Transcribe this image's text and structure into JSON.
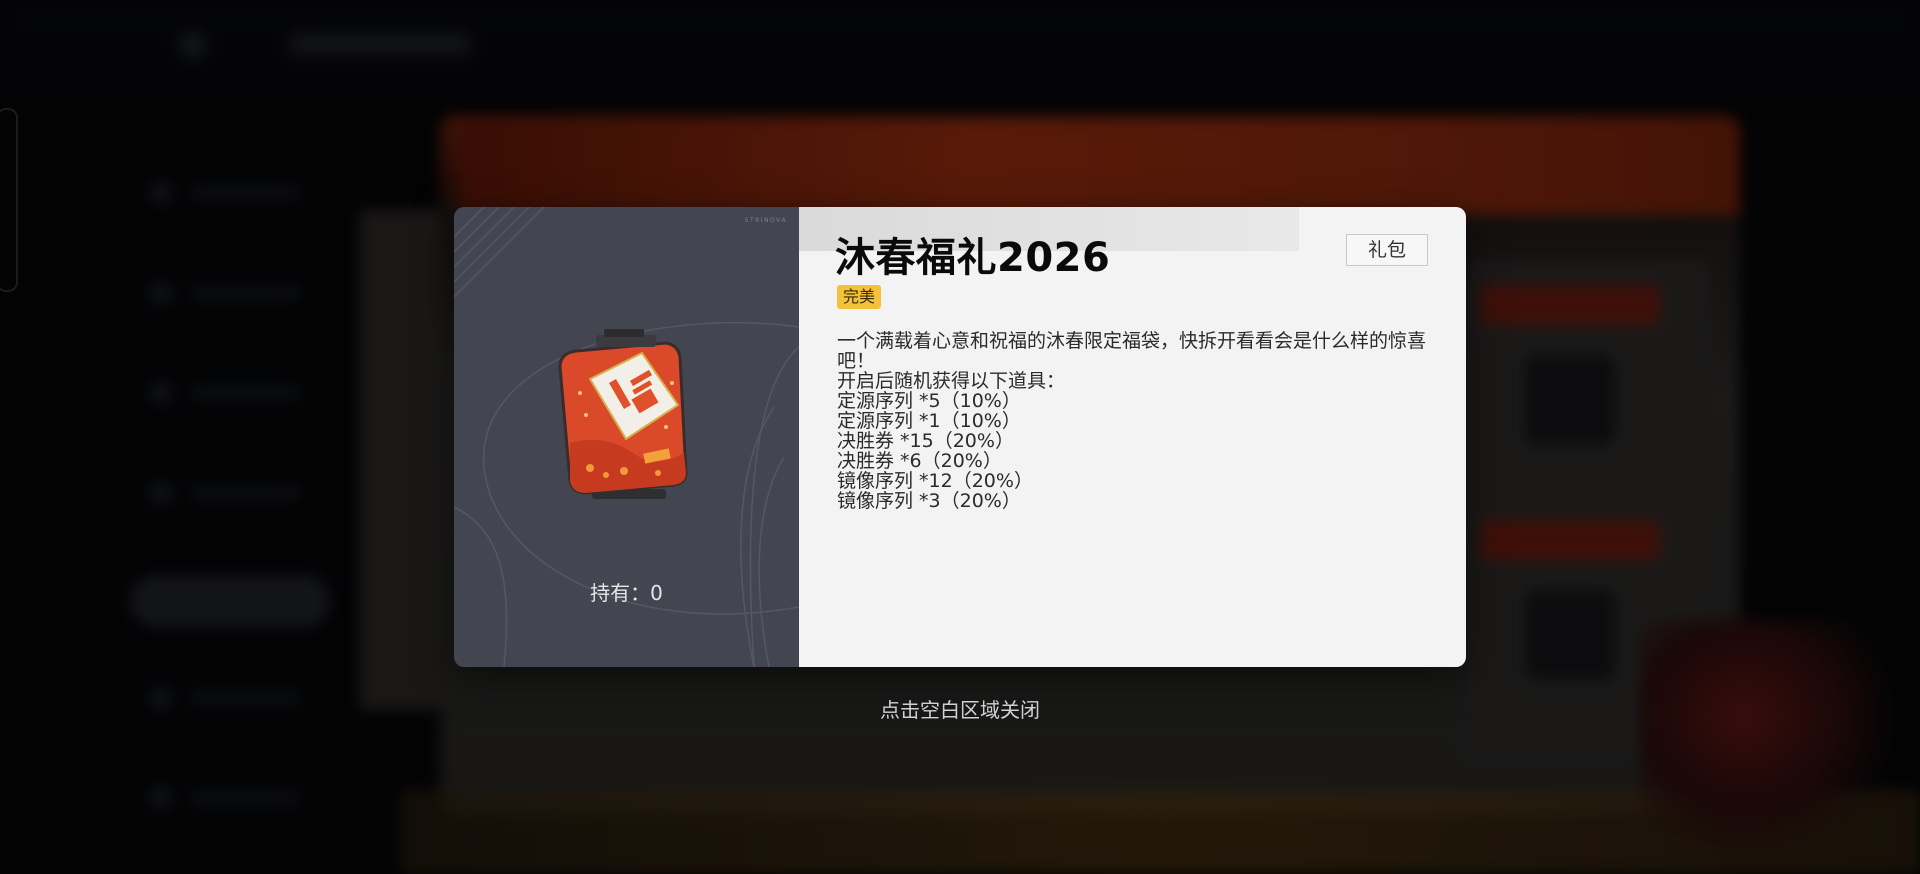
{
  "dialog": {
    "title": "沐春福礼2026",
    "type_tag": "礼包",
    "rarity": "完美",
    "description": "一个满载着心意和祝福的沐春限定福袋，快拆开看看会是什么样的惊喜吧！",
    "drops_intro": "开启后随机获得以下道具：",
    "drops": [
      "定源序列 *5（10%）",
      "定源序列 *1（10%）",
      "决胜券 *15（20%）",
      "决胜券 *6（20%）",
      "镜像序列 *12（20%）",
      "镜像序列 *3（20%）"
    ],
    "held": "持有：0",
    "brand": "STRINOVA"
  },
  "close_hint": "点击空白区域关闭",
  "colors": {
    "rarity_badge": "#f3c23a",
    "panel_left": "#434650",
    "panel_right": "#f3f3f3",
    "item_bag": "#e0502a"
  },
  "icons": {
    "item": "fortune-bag-icon"
  }
}
